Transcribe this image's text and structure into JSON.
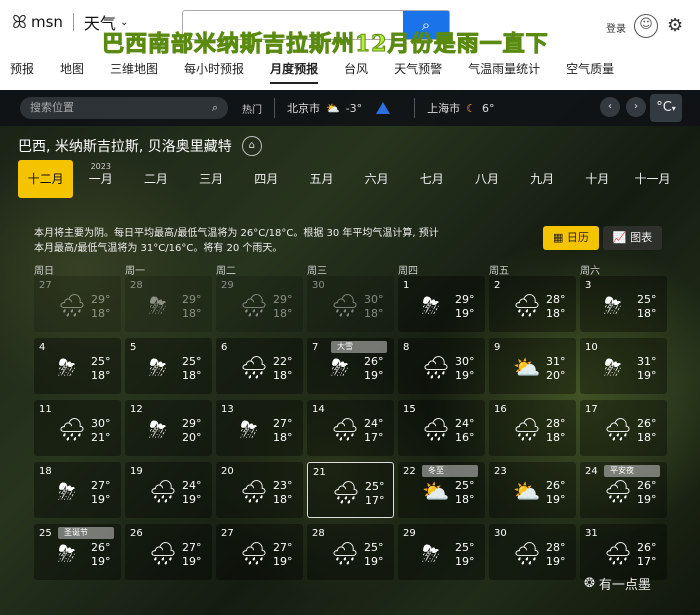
{
  "header": {
    "brand": "msn",
    "product": "天气",
    "search_icon": "search-icon",
    "overlay_text": "巴西南部米纳斯吉拉斯州12月份是雨一直下",
    "login": "登录"
  },
  "nav": [
    "预报",
    "地图",
    "三维地图",
    "每小时预报",
    "月度预报",
    "台风",
    "天气预警",
    "气温雨量统计",
    "空气质量"
  ],
  "nav_active": 4,
  "cityrow": {
    "placeholder": "搜索位置",
    "hot": "热门",
    "city1": "北京市",
    "temp1": "-3°",
    "city2": "上海市",
    "temp2": "6°",
    "unit": "°C"
  },
  "place": "巴西, 米纳斯吉拉斯, 贝洛奥里藏特",
  "months": [
    "十二月",
    "一月",
    "二月",
    "三月",
    "四月",
    "五月",
    "六月",
    "七月",
    "八月",
    "九月",
    "十月",
    "十一月"
  ],
  "year_label": "2023",
  "summary": "本月将主要为阴。每日平均最高/最低气温将为 26°C/18°C。根据 30 年平均气温计算, 预计本月最高/最低气温将为 31°C/16°C。将有 20 个雨天。",
  "view": {
    "calendar": "日历",
    "chart": "图表"
  },
  "weekdays": [
    "周日",
    "周一",
    "周二",
    "周三",
    "周四",
    "周五",
    "周六"
  ],
  "days": [
    {
      "d": "27",
      "hi": "29°",
      "lo": "18°",
      "icon": "rain-cloud",
      "dim": true
    },
    {
      "d": "28",
      "hi": "29°",
      "lo": "18°",
      "icon": "thunder-cloud",
      "dim": true
    },
    {
      "d": "29",
      "hi": "29°",
      "lo": "18°",
      "icon": "rain-cloud",
      "dim": true
    },
    {
      "d": "30",
      "hi": "30°",
      "lo": "18°",
      "icon": "rain-cloud",
      "dim": true
    },
    {
      "d": "1",
      "hi": "29°",
      "lo": "19°",
      "icon": "thunder-cloud"
    },
    {
      "d": "2",
      "hi": "28°",
      "lo": "18°",
      "icon": "rain-cloud"
    },
    {
      "d": "3",
      "hi": "25°",
      "lo": "18°",
      "icon": "thunder-cloud"
    },
    {
      "d": "4",
      "hi": "25°",
      "lo": "18°",
      "icon": "thunder-cloud"
    },
    {
      "d": "5",
      "hi": "25°",
      "lo": "18°",
      "icon": "thunder-cloud"
    },
    {
      "d": "6",
      "hi": "22°",
      "lo": "18°",
      "icon": "heavy-rain-cloud"
    },
    {
      "d": "7",
      "hi": "26°",
      "lo": "19°",
      "icon": "thunder-cloud",
      "tag": "大雪"
    },
    {
      "d": "8",
      "hi": "30°",
      "lo": "19°",
      "icon": "heavy-rain-cloud"
    },
    {
      "d": "9",
      "hi": "31°",
      "lo": "20°",
      "icon": "sun-cloud"
    },
    {
      "d": "10",
      "hi": "31°",
      "lo": "19°",
      "icon": "thunder-cloud"
    },
    {
      "d": "11",
      "hi": "30°",
      "lo": "21°",
      "icon": "rain-cloud"
    },
    {
      "d": "12",
      "hi": "29°",
      "lo": "20°",
      "icon": "thunder-cloud"
    },
    {
      "d": "13",
      "hi": "27°",
      "lo": "18°",
      "icon": "thunder-cloud"
    },
    {
      "d": "14",
      "hi": "24°",
      "lo": "17°",
      "icon": "heavy-rain-cloud"
    },
    {
      "d": "15",
      "hi": "24°",
      "lo": "16°",
      "icon": "heavy-rain-cloud"
    },
    {
      "d": "16",
      "hi": "28°",
      "lo": "18°",
      "icon": "rain-cloud"
    },
    {
      "d": "17",
      "hi": "26°",
      "lo": "18°",
      "icon": "rain-cloud"
    },
    {
      "d": "18",
      "hi": "27°",
      "lo": "19°",
      "icon": "thunder-cloud"
    },
    {
      "d": "19",
      "hi": "24°",
      "lo": "19°",
      "icon": "heavy-rain-cloud"
    },
    {
      "d": "20",
      "hi": "23°",
      "lo": "18°",
      "icon": "heavy-rain-cloud"
    },
    {
      "d": "21",
      "hi": "25°",
      "lo": "17°",
      "icon": "heavy-rain-cloud",
      "today": true
    },
    {
      "d": "22",
      "hi": "25°",
      "lo": "18°",
      "icon": "sun-cloud",
      "tag": "冬至"
    },
    {
      "d": "23",
      "hi": "26°",
      "lo": "19°",
      "icon": "sun-cloud"
    },
    {
      "d": "24",
      "hi": "26°",
      "lo": "19°",
      "icon": "rain-cloud",
      "tag": "平安夜"
    },
    {
      "d": "25",
      "hi": "26°",
      "lo": "19°",
      "icon": "thunder-cloud",
      "tag": "圣诞节"
    },
    {
      "d": "26",
      "hi": "27°",
      "lo": "19°",
      "icon": "heavy-rain-cloud"
    },
    {
      "d": "27",
      "hi": "27°",
      "lo": "19°",
      "icon": "heavy-rain-cloud"
    },
    {
      "d": "28",
      "hi": "25°",
      "lo": "19°",
      "icon": "heavy-rain-cloud"
    },
    {
      "d": "29",
      "hi": "25°",
      "lo": "19°",
      "icon": "thunder-cloud"
    },
    {
      "d": "30",
      "hi": "28°",
      "lo": "19°",
      "icon": "heavy-rain-cloud"
    },
    {
      "d": "31",
      "hi": "26°",
      "lo": "17°",
      "icon": "rain-cloud"
    }
  ],
  "watermark": "有一点墨",
  "colors": {
    "accent": "#f5c400",
    "search_button": "#1a73e8",
    "overlay_text": "#b4f03c",
    "alert": "#2b6fe0"
  }
}
